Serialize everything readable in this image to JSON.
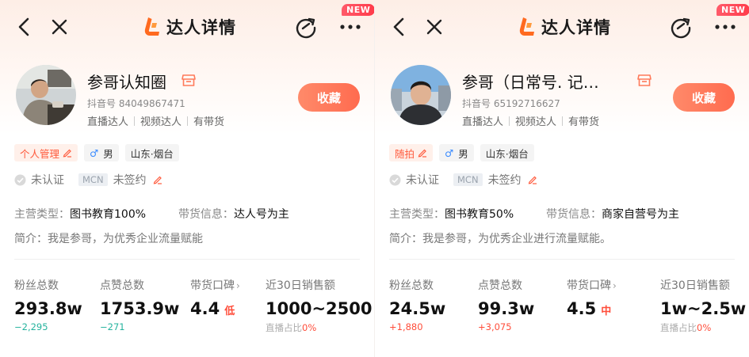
{
  "header": {
    "title": "达人详情",
    "badge": "NEW"
  },
  "panels": [
    {
      "name": "参哥认知圈",
      "douyin_id": "抖音号 84049867471",
      "roles": [
        "直播达人",
        "视频达人",
        "有带货"
      ],
      "favorite_label": "收藏",
      "tags": {
        "personal": "个人管理",
        "gender": "男",
        "region": "山东·烟台"
      },
      "cert": {
        "status": "未认证",
        "mcn_label": "MCN",
        "mcn_status": "未签约"
      },
      "main_category_label": "主营类型：",
      "main_category_value": "图书教育100%",
      "sales_info_label": "带货信息：",
      "sales_info_value": "达人号为主",
      "intro": "简介：我是参哥，为优秀企业流量赋能",
      "stats": {
        "fans_label": "粉丝总数",
        "fans_value": "293.8w",
        "fans_change": "−2,295",
        "likes_label": "点赞总数",
        "likes_value": "1753.9w",
        "likes_change": "−271",
        "rep_label": "带货口碑",
        "rep_value": "4.4",
        "rep_level": "低",
        "sales_label": "近30日销售额",
        "sales_value": "1000~2500",
        "live_share_label": "直播占比",
        "live_share_value": "0%"
      }
    },
    {
      "name": "参哥（日常号. 记…",
      "douyin_id": "抖音号 65192716627",
      "roles": [
        "直播达人",
        "视频达人",
        "有带货"
      ],
      "favorite_label": "收藏",
      "tags": {
        "personal": "随拍",
        "gender": "男",
        "region": "山东·烟台"
      },
      "cert": {
        "status": "未认证",
        "mcn_label": "MCN",
        "mcn_status": "未签约"
      },
      "main_category_label": "主营类型：",
      "main_category_value": "图书教育50%",
      "sales_info_label": "带货信息：",
      "sales_info_value": "商家自营号为主",
      "intro": "简介：我是参哥，为优秀企业进行流量赋能。",
      "stats": {
        "fans_label": "粉丝总数",
        "fans_value": "24.5w",
        "fans_change": "+1,880",
        "likes_label": "点赞总数",
        "likes_value": "99.3w",
        "likes_change": "+3,075",
        "rep_label": "带货口碑",
        "rep_value": "4.5",
        "rep_level": "中",
        "sales_label": "近30日销售额",
        "sales_value": "1w~2.5w",
        "live_share_label": "直播占比",
        "live_share_value": "0%"
      }
    }
  ],
  "colors": {
    "accent": "#ff6b4f",
    "positive_change": "#ff4d3a",
    "negative_change": "#25b39e"
  }
}
